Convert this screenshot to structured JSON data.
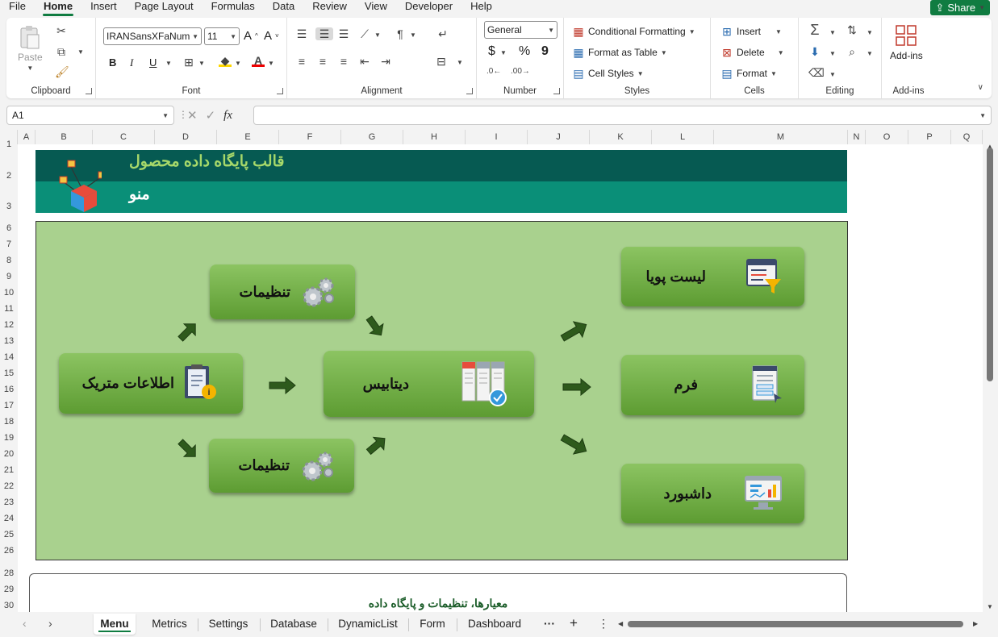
{
  "menu": {
    "tabs": [
      "File",
      "Home",
      "Insert",
      "Page Layout",
      "Formulas",
      "Data",
      "Review",
      "View",
      "Developer",
      "Help"
    ],
    "active_tab": "Home",
    "share_label": "Share"
  },
  "ribbon": {
    "clipboard": {
      "label": "Clipboard",
      "paste": "Paste"
    },
    "font": {
      "label": "Font",
      "family": "IRANSansXFaNum",
      "size": "11",
      "bold": "B",
      "italic": "I",
      "underline": "U",
      "grow": "A^",
      "shrink": "A˅"
    },
    "alignment": {
      "label": "Alignment"
    },
    "number": {
      "label": "Number",
      "format": "General",
      "currency": "$",
      "percent": "%",
      "comma": "9"
    },
    "styles": {
      "label": "Styles",
      "conditional": "Conditional Formatting",
      "format_table": "Format as Table",
      "cell_styles": "Cell Styles"
    },
    "cells": {
      "label": "Cells",
      "insert": "Insert",
      "delete": "Delete",
      "format": "Format"
    },
    "editing": {
      "label": "Editing"
    },
    "addins": {
      "label": "Add-ins",
      "button": "Add-ins"
    }
  },
  "formula_bar": {
    "name_box": "A1",
    "fx": "fx",
    "formula": ""
  },
  "columns": [
    "A",
    "B",
    "C",
    "D",
    "E",
    "F",
    "G",
    "H",
    "I",
    "J",
    "K",
    "L",
    "M",
    "N",
    "O",
    "P",
    "Q"
  ],
  "rows": [
    "1",
    "2",
    "3",
    "6",
    "7",
    "8",
    "9",
    "10",
    "11",
    "12",
    "13",
    "14",
    "15",
    "16",
    "17",
    "18",
    "19",
    "20",
    "21",
    "22",
    "23",
    "24",
    "25",
    "26",
    "28",
    "29",
    "30"
  ],
  "sheet": {
    "banner_title": "قالب پایگاه داده محصول",
    "banner_subtitle": "منو",
    "cards": {
      "settings_top": "تنظیمات",
      "metrics": "اطلاعات متریک",
      "settings_bottom": "تنظیمات",
      "database": "دیتابیس",
      "dynamic_list": "لیست پویا",
      "form": "فرم",
      "dashboard": "داشبورد"
    },
    "note_title": "معیارها، تنظیمات و پایگاه داده"
  },
  "sheet_tabs": [
    "Menu",
    "Metrics",
    "Settings",
    "Database",
    "DynamicList",
    "Form",
    "Dashboard"
  ],
  "active_sheet": "Menu",
  "colors": {
    "accent": "#107c41",
    "banner_dark": "#065a52",
    "banner_light": "#0a8f78",
    "panel": "#a9d18e",
    "card": "#6fae44"
  }
}
